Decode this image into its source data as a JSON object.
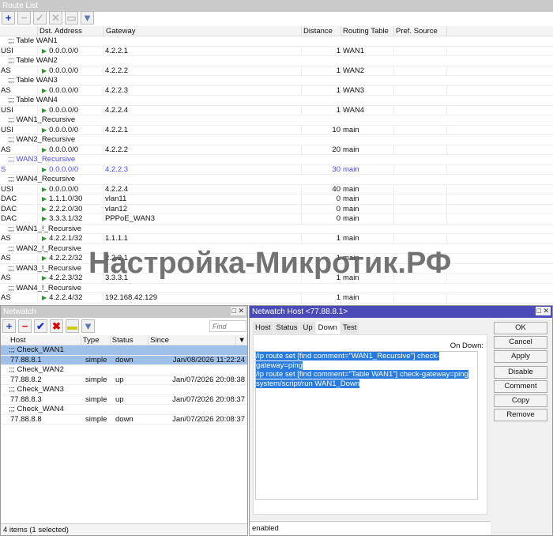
{
  "route_list": {
    "title": "Route List",
    "columns": [
      "",
      "Dst. Address",
      "Gateway",
      "Distance",
      "Routing Table",
      "Pref. Source"
    ],
    "rows": [
      {
        "comment": ";;; Table WAN1"
      },
      {
        "flags": "USI",
        "dst": "0.0.0.0/0",
        "gw": "4.2.2.1",
        "dist": "1",
        "table": "WAN1"
      },
      {
        "comment": ";;; Table WAN2"
      },
      {
        "flags": "AS",
        "dst": "0.0.0.0/0",
        "gw": "4.2.2.2",
        "dist": "1",
        "table": "WAN2"
      },
      {
        "comment": ";;; Table WAN3"
      },
      {
        "flags": "AS",
        "dst": "0.0.0.0/0",
        "gw": "4.2.2.3",
        "dist": "1",
        "table": "WAN3"
      },
      {
        "comment": ";;; Table WAN4"
      },
      {
        "flags": "USI",
        "dst": "0.0.0.0/0",
        "gw": "4.2.2.4",
        "dist": "1",
        "table": "WAN4"
      },
      {
        "comment": ";;; WAN1_Recursive"
      },
      {
        "flags": "USI",
        "dst": "0.0.0.0/0",
        "gw": "4.2.2.1",
        "dist": "10",
        "table": "main"
      },
      {
        "comment": ";;; WAN2_Recursive"
      },
      {
        "flags": "AS",
        "dst": "0.0.0.0/0",
        "gw": "4.2.2.2",
        "dist": "20",
        "table": "main"
      },
      {
        "comment": ";;; WAN3_Recursive",
        "sel": true
      },
      {
        "flags": "S",
        "dst": "0.0.0.0/0",
        "gw": "4.2.2.3",
        "dist": "30",
        "table": "main",
        "sel": true
      },
      {
        "comment": ";;; WAN4_Recursive"
      },
      {
        "flags": "USI",
        "dst": "0.0.0.0/0",
        "gw": "4.2.2.4",
        "dist": "40",
        "table": "main"
      },
      {
        "flags": "DAC",
        "dst": "1.1.1.0/30",
        "gw": "vlan11",
        "dist": "0",
        "table": "main"
      },
      {
        "flags": "DAC",
        "dst": "2.2.2.0/30",
        "gw": "vlan12",
        "dist": "0",
        "table": "main"
      },
      {
        "flags": "DAC",
        "dst": "3.3.3.1/32",
        "gw": "PPPoE_WAN3",
        "dist": "0",
        "table": "main"
      },
      {
        "comment": ";;; WAN1_!_Recursive"
      },
      {
        "flags": "AS",
        "dst": "4.2.2.1/32",
        "gw": "1.1.1.1",
        "dist": "1",
        "table": "main"
      },
      {
        "comment": ";;; WAN2_!_Recursive"
      },
      {
        "flags": "AS",
        "dst": "4.2.2.2/32",
        "gw": "2.2.2.1",
        "dist": "1",
        "table": "main"
      },
      {
        "comment": ";;; WAN3_!_Recursive"
      },
      {
        "flags": "AS",
        "dst": "4.2.2.3/32",
        "gw": "3.3.3.1",
        "dist": "1",
        "table": "main"
      },
      {
        "comment": ";;; WAN4_!_Recursive"
      },
      {
        "flags": "AS",
        "dst": "4.2.2.4/32",
        "gw": "192.168.42.129",
        "dist": "1",
        "table": "main"
      }
    ]
  },
  "watermark": "Настройка-Микротик.РФ",
  "netwatch": {
    "title": "Netwatch",
    "find_placeholder": "Find",
    "columns": [
      "Host",
      "Type",
      "Status",
      "Since"
    ],
    "rows": [
      {
        "comment": ";;; Check_WAN1",
        "sel": true
      },
      {
        "host": "77.88.8.1",
        "type": "simple",
        "status": "down",
        "since": "Jan/08/2026 11:22:24",
        "sel": true
      },
      {
        "comment": ";;; Check_WAN2"
      },
      {
        "host": "77.88.8.2",
        "type": "simple",
        "status": "up",
        "since": "Jan/07/2026 20:08:38"
      },
      {
        "comment": ";;; Check_WAN3"
      },
      {
        "host": "77.88.8.3",
        "type": "simple",
        "status": "up",
        "since": "Jan/07/2026 20:08:37"
      },
      {
        "comment": ";;; Check_WAN4"
      },
      {
        "host": "77.88.8.8",
        "type": "simple",
        "status": "down",
        "since": "Jan/07/2026 20:08:37"
      }
    ],
    "status": "4 items (1 selected)"
  },
  "host_dialog": {
    "title": "Netwatch Host <77.88.8.1>",
    "tabs": [
      "Host",
      "Status",
      "Up",
      "Down",
      "Test"
    ],
    "active_tab": "Down",
    "label": "On Down:",
    "script_lines": [
      "/ip route set [find comment=\"WAN1_Recursive\"] check-",
      "gateway=ping",
      "/ip route set [find comment=\"Table WAN1\"] check-gateway=ping",
      "system/script/run WAN1_Down"
    ],
    "buttons": [
      "OK",
      "Cancel",
      "Apply",
      "Disable",
      "Comment",
      "Copy",
      "Remove"
    ],
    "status": "enabled"
  }
}
